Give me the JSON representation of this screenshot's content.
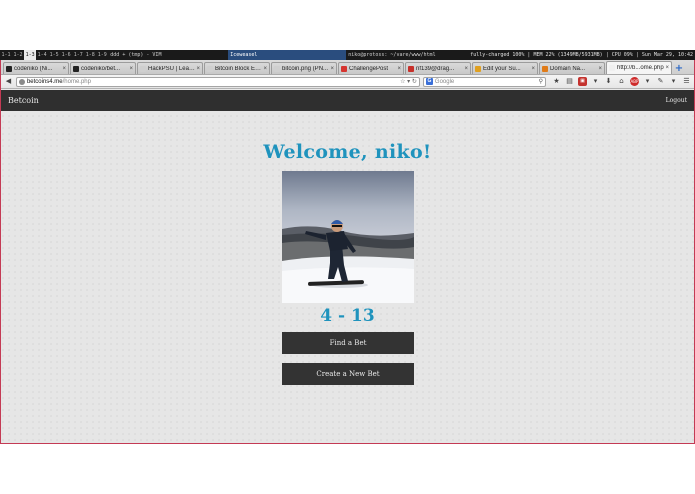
{
  "system_bar": {
    "workspaces": [
      "1-1",
      "1-2",
      "1-3",
      "1-4",
      "1-5",
      "1-6",
      "1-7",
      "1-8",
      "1-9"
    ],
    "active_workspace": "1-3",
    "windows": [
      {
        "label": "ddd + (tmp) - VIM",
        "focused": false
      },
      {
        "label": "Iceweasel",
        "focused": true
      },
      {
        "label": "niko@protoss: ~/vare/www/html",
        "focused": false
      }
    ],
    "status": "fully-charged 100% | MEM 22% (1349MB/5931MB) | CPU 09% | Sun Mar 29, 10:42"
  },
  "browser": {
    "tabs": [
      {
        "label": "codeniko (Ni...",
        "favicon_color": "#222222",
        "active": false
      },
      {
        "label": "codeniko/bet...",
        "favicon_color": "#222222",
        "active": false
      },
      {
        "label": "HackPSU | Lear...",
        "favicon_color": "#cfcfcf",
        "active": false
      },
      {
        "label": "Bitcoin Block Ex...",
        "favicon_color": "#cfcfcf",
        "active": false
      },
      {
        "label": "bitcoin.png (PN...",
        "favicon_color": "#cfcfcf",
        "active": false
      },
      {
        "label": "ChallengePost",
        "favicon_color": "#d6342f",
        "active": false
      },
      {
        "label": "nf139@drag...",
        "favicon_color": "#c7302a",
        "active": false
      },
      {
        "label": "Edit your Su...",
        "favicon_color": "#e0a020",
        "active": false
      },
      {
        "label": "Domain Na...",
        "favicon_color": "#e07b18",
        "active": false
      },
      {
        "label": "http://b...ome.php",
        "favicon_color": "#f0f0f0",
        "active": true
      }
    ],
    "url_host": "betcoins4.me",
    "url_path": "/home.php",
    "search_placeholder": "Google",
    "search_engine_icon": "G",
    "icons": {
      "back": "back-arrow-icon",
      "reload": "reload-icon",
      "search": "magnifier-icon",
      "bookmark": "star-icon",
      "bookmarks_menu": "clipboard-icon",
      "download": "download-arrow-icon",
      "home": "home-icon",
      "menu": "hamburger-menu-icon"
    }
  },
  "site": {
    "brand": "Betcoin",
    "logout": "Logout",
    "welcome": "Welcome, niko!",
    "record": "4 - 13",
    "find_bet": "Find a Bet",
    "create_bet": "Create a New Bet",
    "accent_color": "#1f93bd"
  }
}
